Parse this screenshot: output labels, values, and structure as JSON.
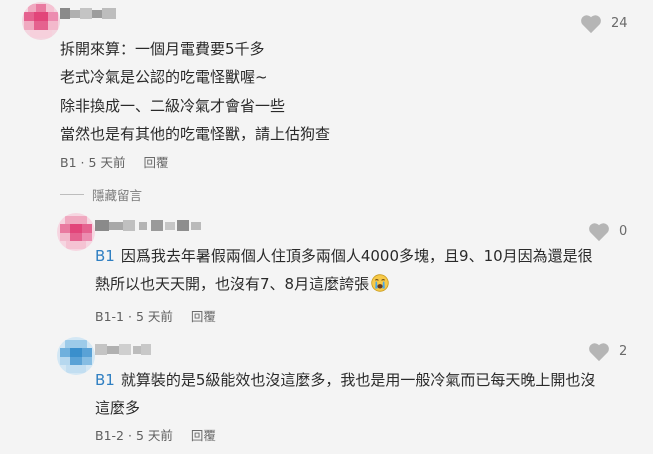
{
  "main_comment": {
    "likes": "24",
    "lines": [
      "拆開來算：一個月電費要5千多",
      "老式冷氣是公認的吃電怪獸喔~",
      "除非換成一、二級冷氣才會省一些",
      "當然也是有其他的吃電怪獸，請上估狗查"
    ],
    "floor": "B1",
    "time": "5 天前",
    "reply_label": "回覆"
  },
  "hide_replies_label": "隱藏留言",
  "replies": [
    {
      "likes": "0",
      "tag": "B1",
      "line1": "因爲我去年暑假兩個人住頂多兩個人4000多塊，且9、10月因為還是很",
      "line2": "熱所以也天天開，也沒有7、8月這麼誇張",
      "floor": "B1-1",
      "time": "5 天前",
      "reply_label": "回覆"
    },
    {
      "likes": "2",
      "tag": "B1",
      "line1": "就算裝的是5級能效也沒這麼多，我也是用一般冷氣而已每天晚上開也沒",
      "line2": "這麼多",
      "floor": "B1-2",
      "time": "5 天前",
      "reply_label": "回覆"
    }
  ],
  "colors": {
    "background": "#f4f4f4",
    "floor_tag": "#2f7fc2",
    "avatar_pink": "#e2457a",
    "avatar_blue": "#3a8fcc"
  }
}
